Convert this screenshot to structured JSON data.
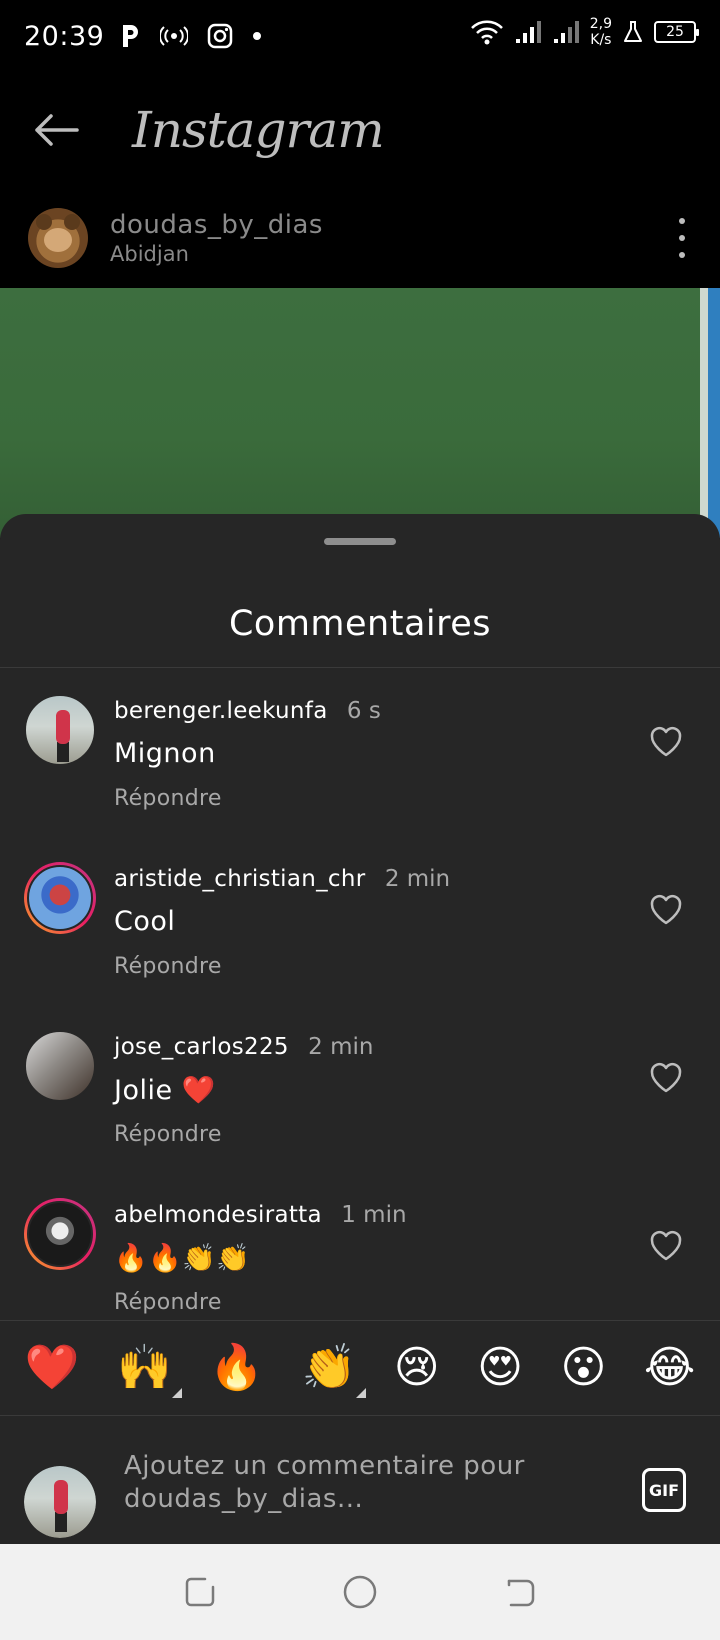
{
  "status_bar": {
    "time": "20:39",
    "net_speed_value": "2,9",
    "net_speed_unit": "K/s",
    "battery": "25"
  },
  "header": {
    "logo": "Instagram"
  },
  "post": {
    "username": "doudas_by_dias",
    "location": "Abidjan"
  },
  "sheet": {
    "title": "Commentaires"
  },
  "comments": [
    {
      "username": "berenger.leekunfa",
      "time": "6 s",
      "text": "Mignon",
      "reply": "Répondre"
    },
    {
      "username": "aristide_christian_chr",
      "time": "2 min",
      "text": "Cool",
      "reply": "Répondre"
    },
    {
      "username": "jose_carlos225",
      "time": "2 min",
      "text": "Jolie ❤️",
      "reply": "Répondre"
    },
    {
      "username": "abelmondesiratta",
      "time": "1 min",
      "text": "🔥🔥👏👏",
      "reply": "Répondre"
    }
  ],
  "emoji_bar": [
    "❤️",
    "🙌",
    "🔥",
    "👏",
    "😢",
    "😍",
    "😮",
    "😂"
  ],
  "composer": {
    "placeholder_line1": "Ajoutez un commentaire pour",
    "placeholder_line2": "doudas_by_dias...",
    "gif_label": "GIF"
  },
  "colors": {
    "sheet_bg": "#262626",
    "secondary_text": "#a8a8a8",
    "like_red": "#ed4956"
  }
}
